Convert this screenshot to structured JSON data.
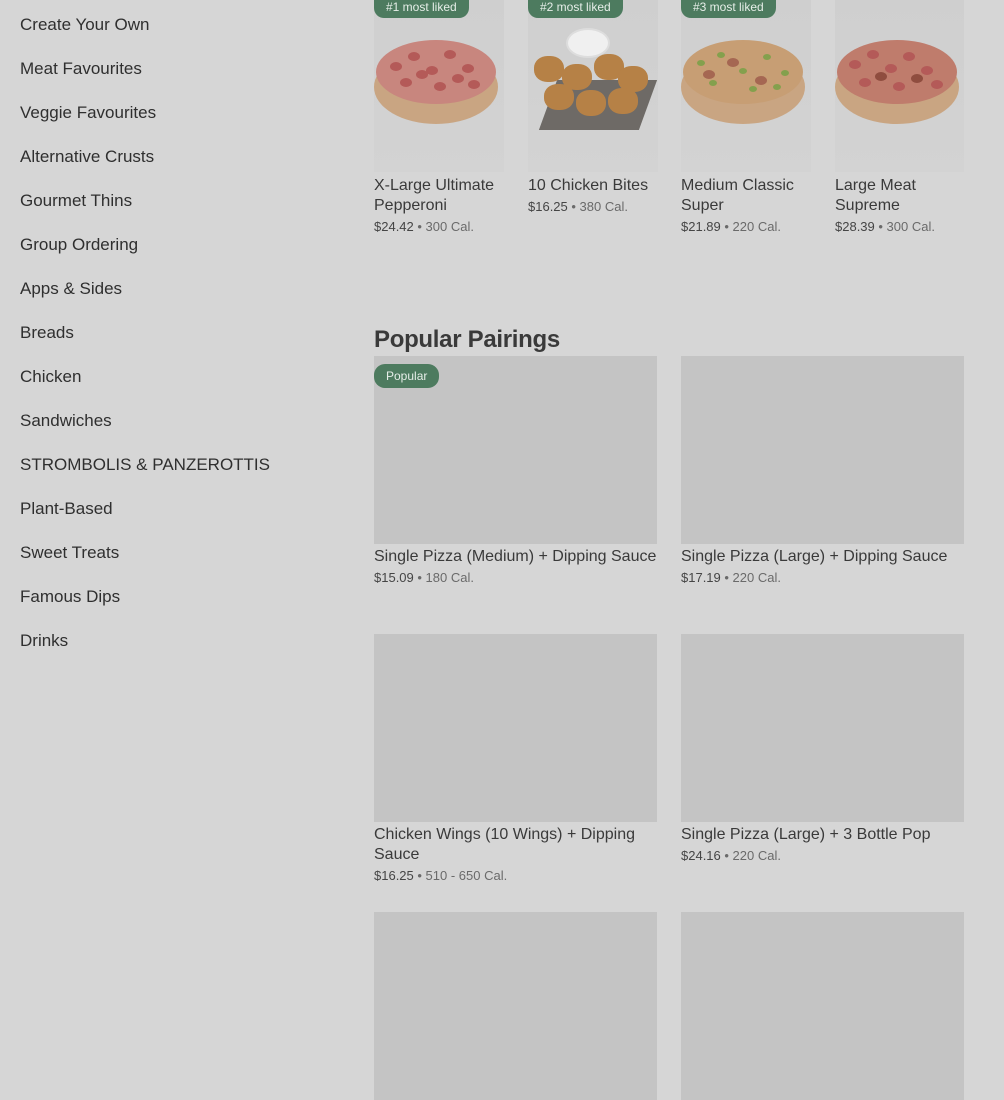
{
  "sidebar": {
    "items": [
      {
        "label": "Create Your Own"
      },
      {
        "label": "Meat Favourites"
      },
      {
        "label": "Veggie Favourites"
      },
      {
        "label": "Alternative Crusts"
      },
      {
        "label": "Gourmet Thins"
      },
      {
        "label": "Group Ordering"
      },
      {
        "label": "Apps & Sides"
      },
      {
        "label": "Breads"
      },
      {
        "label": "Chicken"
      },
      {
        "label": "Sandwiches"
      },
      {
        "label": "STROMBOLIS & PANZEROTTIS"
      },
      {
        "label": "Plant-Based"
      },
      {
        "label": "Sweet Treats"
      },
      {
        "label": "Famous Dips"
      },
      {
        "label": "Drinks"
      }
    ]
  },
  "most_liked": [
    {
      "badge": "#1 most liked",
      "title": "X-Large Ultimate Pepperoni",
      "price": "$24.42",
      "sep": " • ",
      "calories": "300 Cal."
    },
    {
      "badge": "#2 most liked",
      "title": "10 Chicken Bites",
      "price": "$16.25",
      "sep": " • ",
      "calories": "380 Cal."
    },
    {
      "badge": "#3 most liked",
      "title": "Medium Classic Super",
      "price": "$21.89",
      "sep": " • ",
      "calories": "220 Cal."
    },
    {
      "badge": "",
      "title": "Large Meat Supreme",
      "price": "$28.39",
      "sep": " • ",
      "calories": "300 Cal."
    }
  ],
  "popular_pairings": {
    "title": "Popular Pairings",
    "badge": "Popular",
    "items": [
      {
        "title": "Single Pizza (Medium) + Dipping Sauce",
        "price": "$15.09",
        "sep": " • ",
        "calories": "180 Cal."
      },
      {
        "title": "Single Pizza (Large) + Dipping Sauce",
        "price": "$17.19",
        "sep": " • ",
        "calories": "220 Cal."
      },
      {
        "title": "Chicken Wings (10 Wings) + Dipping Sauce",
        "price": "$16.25",
        "sep": " • ",
        "calories": "510 - 650 Cal."
      },
      {
        "title": "Single Pizza (Large) + 3 Bottle Pop",
        "price": "$24.16",
        "sep": " • ",
        "calories": "220 Cal."
      }
    ]
  },
  "colors": {
    "badge": "#4d7b5f",
    "overlay": "#d6d6d6"
  }
}
